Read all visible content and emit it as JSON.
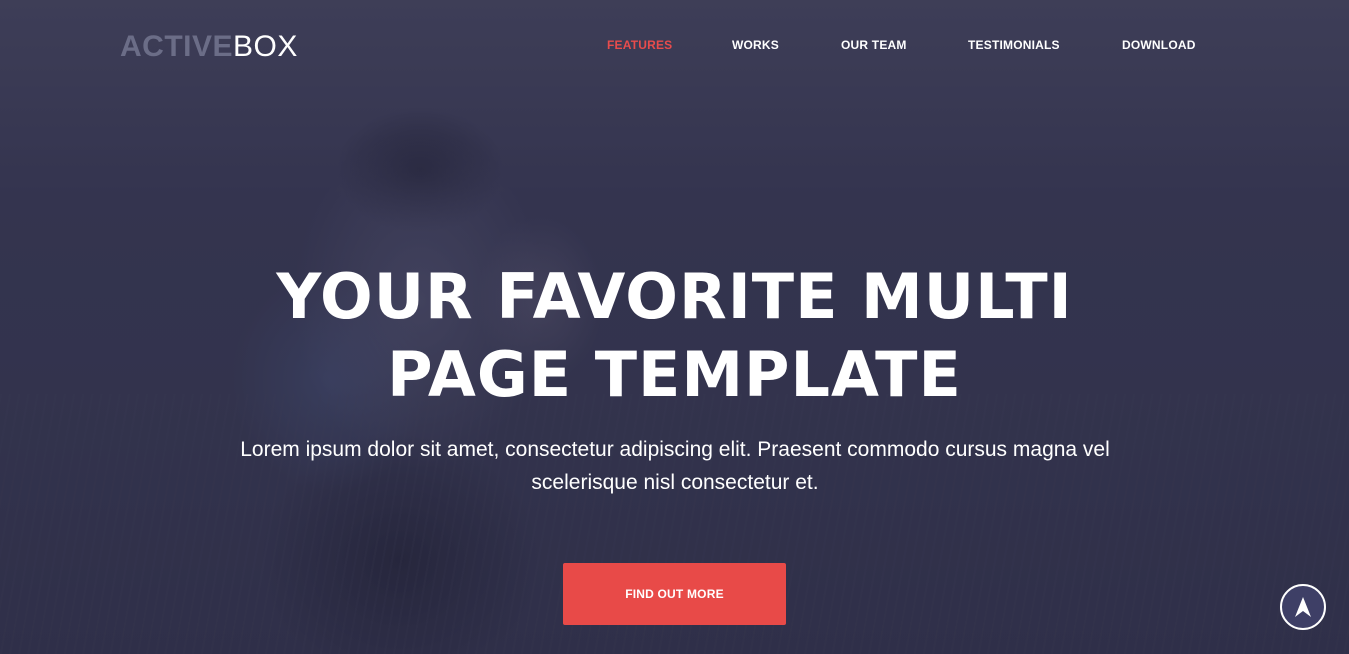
{
  "logo": {
    "part1": "ACTIVE",
    "part2": "BOX"
  },
  "nav": {
    "items": [
      {
        "label": "FEATURES",
        "active": true
      },
      {
        "label": "WORKS",
        "active": false
      },
      {
        "label": "OUR TEAM",
        "active": false
      },
      {
        "label": "TESTIMONIALS",
        "active": false
      },
      {
        "label": "DOWNLOAD",
        "active": false
      }
    ]
  },
  "hero": {
    "headline_line1": "YOUR FAVORITE MULTI",
    "headline_line2": "PAGE TEMPLATE",
    "subtext": "Lorem ipsum dolor sit amet, consectetur adipiscing elit. Praesent commodo cursus magna vel scelerisque nisl consectetur et.",
    "cta_label": "FIND OUT MORE"
  },
  "icons": {
    "scroll_top": "arrow-up-icon"
  },
  "colors": {
    "accent": "#e84a48",
    "active_nav": "#e84c4c",
    "logo_muted": "#6b6d87",
    "overlay": "#3a3a54"
  }
}
